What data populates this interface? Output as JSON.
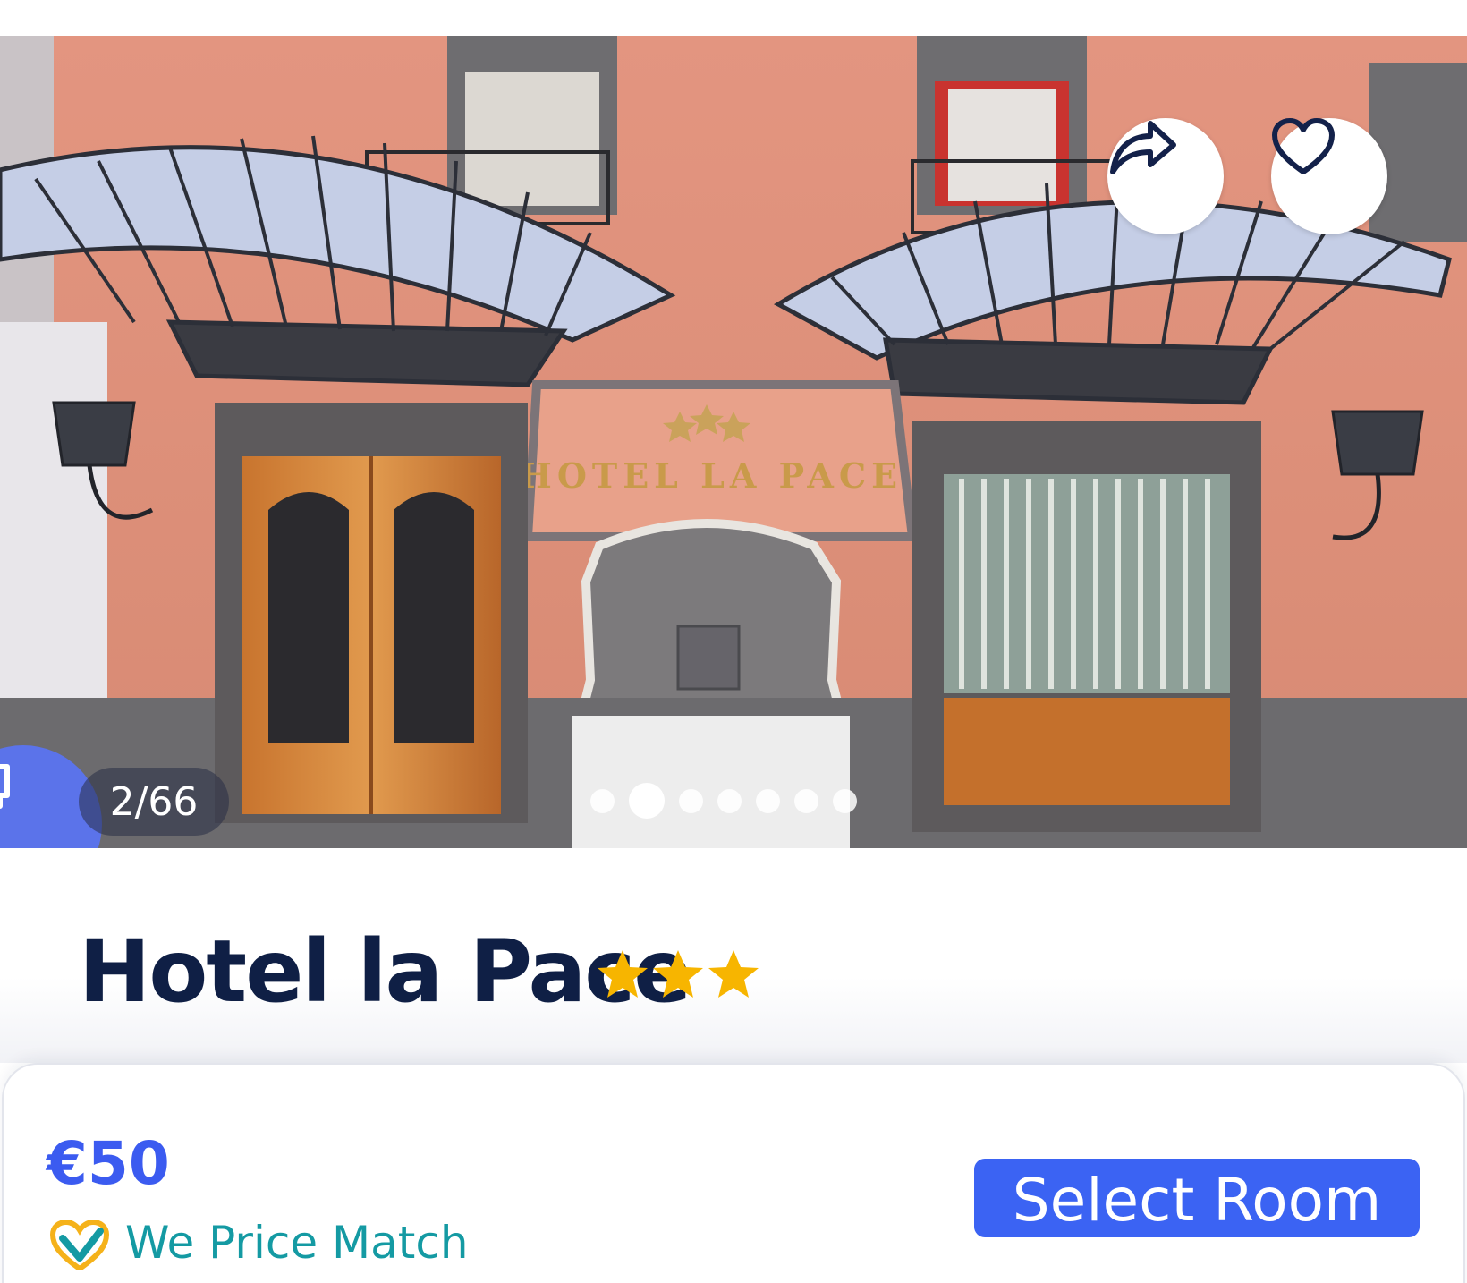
{
  "gallery": {
    "counter": "2/66",
    "dot_count": 7,
    "active_dot": 1,
    "sign_text": "HOTEL LA PACE",
    "share_icon": "share-arrow-icon",
    "favorite_icon": "heart-outline-icon",
    "chat_icon": "chat-bubbles-icon"
  },
  "hotel": {
    "name": "Hotel la Pace",
    "star_rating": 3,
    "star_color": "#f7b500"
  },
  "booking": {
    "price": "€50",
    "price_match_label": "We Price Match",
    "price_match_icon": "heart-check-icon",
    "select_button_label": "Select Room"
  },
  "colors": {
    "primary_blue": "#3b63f3",
    "price_blue": "#3b5bf0",
    "title_navy": "#0f1f45",
    "teal": "#149aa3"
  }
}
